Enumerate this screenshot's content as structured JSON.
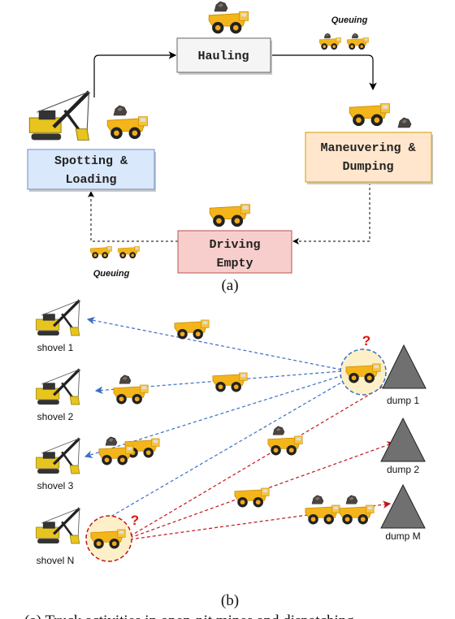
{
  "panel_a": {
    "caption": "(a)",
    "states": {
      "hauling": "Hauling",
      "maneuvering_line1": "Maneuvering &",
      "maneuvering_line2": "Dumping",
      "driving_line1": "Driving",
      "driving_line2": "Empty",
      "spotting_line1": "Spotting &",
      "spotting_line2": "Loading"
    },
    "queue_label_top": "Queuing",
    "queue_label_bottom": "Queuing",
    "colors": {
      "hauling": "#f5f5f5",
      "maneuvering": "#ffe6cc",
      "driving": "#f8cecc",
      "spotting": "#dae8fc"
    }
  },
  "panel_b": {
    "caption": "(b)",
    "shovels": [
      "shovel 1",
      "shovel 2",
      "shovel 3",
      "shovel N"
    ],
    "dumps": [
      "dump 1",
      "dump 2",
      "dump M"
    ],
    "question_mark": "?",
    "colors": {
      "loaded_truck_routes": "#3a6fc4",
      "empty_truck_routes": "#c0151b",
      "dump": "#707070"
    }
  },
  "bottom_caption_fragment": "(a) Truck activities in open-pit mines and dispatching"
}
